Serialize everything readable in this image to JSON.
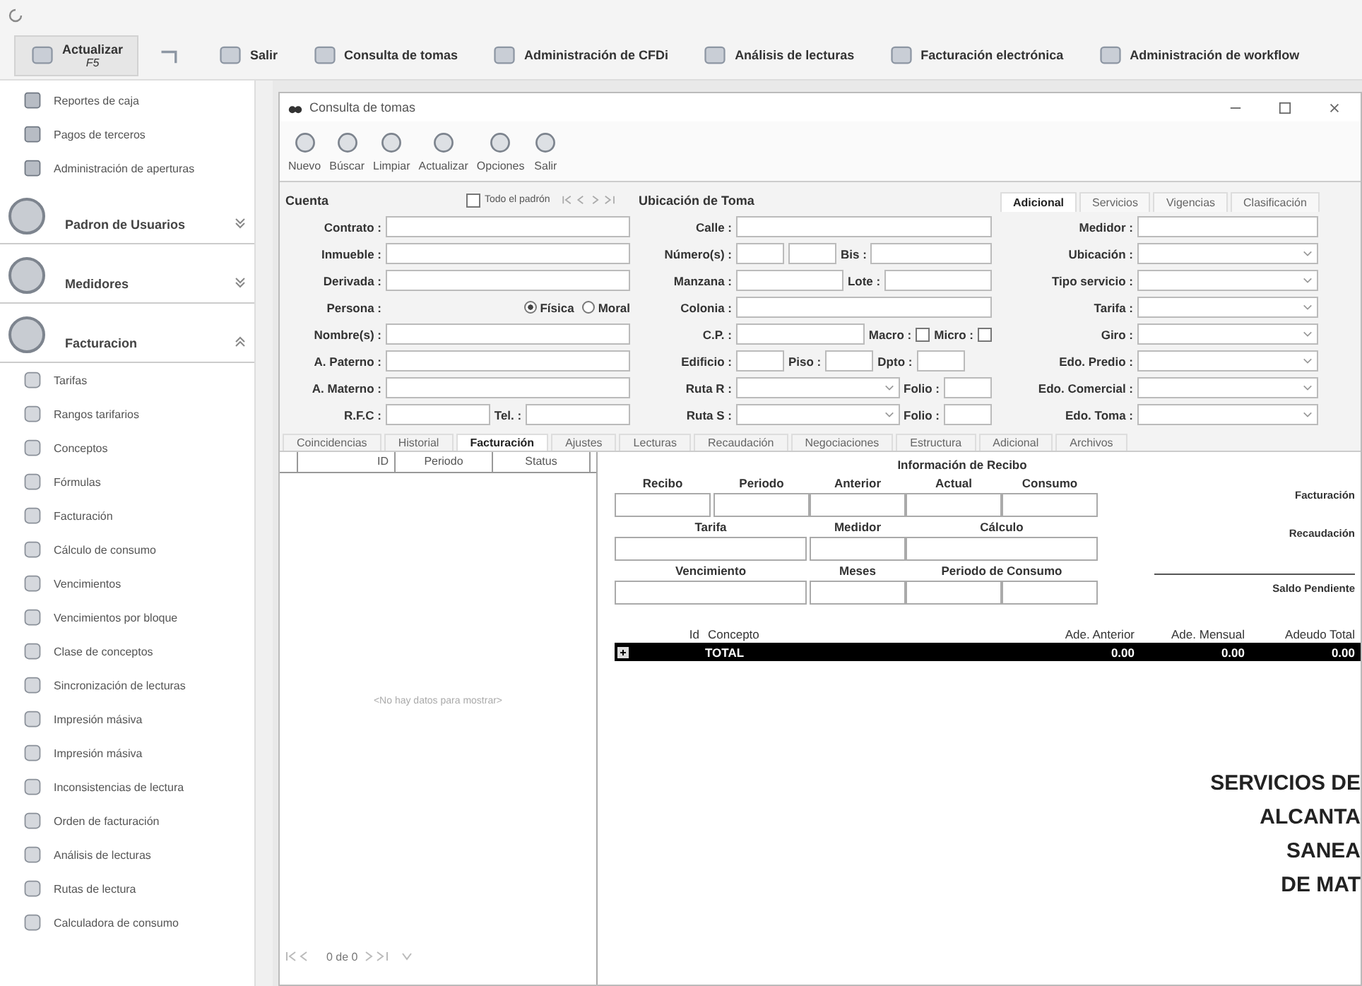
{
  "toolbar": [
    {
      "kind": "labeled",
      "label": "Actualizar",
      "shortcut": "F5"
    },
    {
      "kind": "icon"
    },
    {
      "kind": "labeled",
      "label": "Salir"
    },
    {
      "kind": "labeled",
      "label": "Consulta de tomas"
    },
    {
      "kind": "labeled",
      "label": "Administración de CFDi"
    },
    {
      "kind": "labeled",
      "label": "Análisis de lecturas"
    },
    {
      "kind": "labeled",
      "label": "Facturación electrónica"
    },
    {
      "kind": "labeled",
      "label": "Administración de workflow"
    }
  ],
  "sidebar": {
    "items": [
      {
        "kind": "item",
        "label": "Reportes de caja"
      },
      {
        "kind": "item",
        "label": "Pagos de terceros"
      },
      {
        "kind": "item",
        "label": "Administración de aperturas"
      },
      {
        "kind": "group",
        "label": "Padron de Usuarios",
        "expanded": false
      },
      {
        "kind": "group",
        "label": "Medidores",
        "expanded": false
      },
      {
        "kind": "group",
        "label": "Facturacion",
        "expanded": true,
        "children": [
          {
            "label": "Tarifas"
          },
          {
            "label": "Rangos tarifarios"
          },
          {
            "label": "Conceptos"
          },
          {
            "label": "Fórmulas"
          },
          {
            "label": "Facturación"
          },
          {
            "label": "Cálculo de consumo"
          },
          {
            "label": "Vencimientos"
          },
          {
            "label": "Vencimientos por bloque"
          },
          {
            "label": "Clase de conceptos"
          },
          {
            "label": "Sincronización de lecturas"
          },
          {
            "label": "Impresión másiva"
          },
          {
            "label": "Impresión másiva"
          },
          {
            "label": "Inconsistencias de lectura"
          },
          {
            "label": "Orden de facturación"
          },
          {
            "label": "Análisis de lecturas"
          },
          {
            "label": "Rutas de lectura"
          },
          {
            "label": "Calculadora de consumo"
          }
        ]
      }
    ]
  },
  "window": {
    "title": "Consulta de tomas",
    "toolbar": [
      "Nuevo",
      "Búscar",
      "Limpiar",
      "Actualizar",
      "Opciones",
      "Salir"
    ],
    "cuenta": {
      "title": "Cuenta",
      "all_checkbox": {
        "label": "Todo el padrón",
        "checked": false
      },
      "rows": [
        [
          {
            "label": "Contrato :",
            "kind": "text"
          }
        ],
        [
          {
            "label": "Inmueble :",
            "kind": "text"
          }
        ],
        [
          {
            "label": "Derivada :",
            "kind": "text"
          }
        ],
        [
          {
            "label": "Persona :",
            "kind": "radio",
            "options": [
              {
                "label": "Física",
                "selected": true
              },
              {
                "label": "Moral",
                "selected": false
              }
            ]
          }
        ],
        [
          {
            "label": "Nombre(s) :",
            "kind": "text"
          }
        ],
        [
          {
            "label": "A. Paterno :",
            "kind": "text"
          }
        ],
        [
          {
            "label": "A. Materno :",
            "kind": "text"
          }
        ],
        [
          {
            "label": "R.F.C :",
            "kind": "text"
          },
          {
            "label": "Tel. :",
            "kind": "text"
          }
        ]
      ]
    },
    "ubicacion": {
      "title": "Ubicación de Toma",
      "rows": [
        [
          {
            "label": "Calle :",
            "kind": "text"
          }
        ],
        [
          {
            "label": "Número(s) :",
            "kind": "pair"
          },
          {
            "label": "Bis :",
            "kind": "text"
          }
        ],
        [
          {
            "label": "Manzana :",
            "kind": "text"
          },
          {
            "label": "Lote :",
            "kind": "text"
          }
        ],
        [
          {
            "label": "Colonia :",
            "kind": "text"
          }
        ],
        [
          {
            "label": "C.P. :",
            "kind": "text"
          },
          {
            "label": "Macro :",
            "kind": "check",
            "checked": false
          },
          {
            "label": "Micro :",
            "kind": "check",
            "checked": false
          }
        ],
        [
          {
            "label": "Edificio :",
            "kind": "short"
          },
          {
            "label": "Piso :",
            "kind": "short"
          },
          {
            "label": "Dpto :",
            "kind": "short"
          }
        ],
        [
          {
            "label": "Ruta R :",
            "kind": "select"
          },
          {
            "label": "Folio :",
            "kind": "short"
          }
        ],
        [
          {
            "label": "Ruta S :",
            "kind": "select"
          },
          {
            "label": "Folio :",
            "kind": "short"
          }
        ]
      ]
    },
    "side_tabs": [
      {
        "label": "Adicional",
        "selected": true
      },
      {
        "label": "Servicios",
        "selected": false
      },
      {
        "label": "Vigencias",
        "selected": false
      },
      {
        "label": "Clasificación",
        "selected": false
      }
    ],
    "adicional": [
      {
        "label": "Medidor :",
        "kind": "text"
      },
      {
        "label": "Ubicación :",
        "kind": "select"
      },
      {
        "label": "Tipo servicio :",
        "kind": "select"
      },
      {
        "label": "Tarifa :",
        "kind": "select"
      },
      {
        "label": "Giro :",
        "kind": "select"
      },
      {
        "label": "Edo. Predio :",
        "kind": "select"
      },
      {
        "label": "Edo. Comercial :",
        "kind": "select"
      },
      {
        "label": "Edo. Toma :",
        "kind": "select"
      }
    ],
    "tabs": [
      {
        "label": "Coincidencias",
        "selected": false
      },
      {
        "label": "Historial",
        "selected": false
      },
      {
        "label": "Facturación",
        "selected": true
      },
      {
        "label": "Ajustes",
        "selected": false
      },
      {
        "label": "Lecturas",
        "selected": false
      },
      {
        "label": "Recaudación",
        "selected": false
      },
      {
        "label": "Negociaciones",
        "selected": false
      },
      {
        "label": "Estructura",
        "selected": false
      },
      {
        "label": "Adicional",
        "selected": false
      },
      {
        "label": "Archivos",
        "selected": false
      }
    ],
    "grid": {
      "columns": [
        "ID",
        "Periodo",
        "Status"
      ],
      "empty_text": "<No hay datos para mostrar>",
      "pager": "0 de 0"
    },
    "recibo": {
      "title": "Información de Recibo",
      "field_lines": [
        {
          "fields": [
            {
              "label": "Recibo",
              "kind": "single"
            },
            {
              "label": "Periodo",
              "kind": "single"
            },
            {
              "label": "Anterior",
              "kind": "single"
            },
            {
              "label": "Actual",
              "kind": "single"
            },
            {
              "label": "Consumo",
              "kind": "single"
            }
          ]
        },
        {
          "fields": [
            {
              "label": "Tarifa",
              "kind": "wide"
            },
            {
              "label": "Medidor",
              "kind": "single"
            },
            {
              "label": "Cálculo",
              "kind": "wide"
            }
          ]
        },
        {
          "fields": [
            {
              "label": "Vencimiento",
              "kind": "wide"
            },
            {
              "label": "Meses",
              "kind": "single"
            },
            {
              "label": "Periodo de Consumo",
              "kind": "pair"
            }
          ]
        }
      ],
      "summary": [
        "Facturación",
        "Recaudación",
        "Saldo Pendiente"
      ],
      "columns": [
        "Id",
        "Concepto",
        "Ade. Anterior",
        "Ade. Mensual",
        "Adeudo Total"
      ],
      "total": {
        "label": "TOTAL",
        "values": [
          "0.00",
          "0.00",
          "0.00"
        ]
      }
    },
    "brand_lines": [
      "SERVICIOS DE",
      "ALCANTA",
      "SANEA",
      "DE MAT"
    ]
  }
}
